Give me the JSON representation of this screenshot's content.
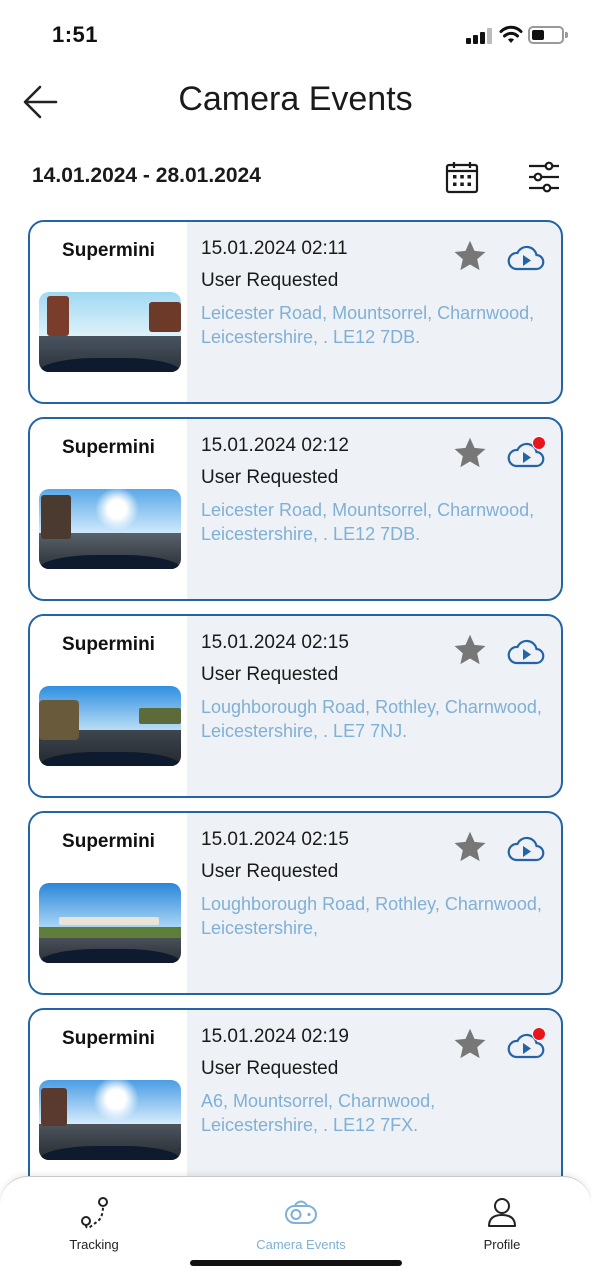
{
  "status_bar": {
    "time": "1:51"
  },
  "header": {
    "title": "Camera Events"
  },
  "date_range": "14.01.2024 - 28.01.2024",
  "colors": {
    "accent": "#2463a8",
    "address": "#7fb0d6",
    "new_badge": "#e8151b",
    "star": "#777777"
  },
  "events": [
    {
      "vehicle": "Supermini",
      "datetime": "15.01.2024 02:11",
      "type": "User Requested",
      "address": "Leicester Road, Mountsorrel, Charnwood, Leicestershire, . LE12 7DB.",
      "is_new": false
    },
    {
      "vehicle": "Supermini",
      "datetime": "15.01.2024 02:12",
      "type": "User Requested",
      "address": "Leicester Road, Mountsorrel, Charnwood, Leicestershire, . LE12 7DB.",
      "is_new": true
    },
    {
      "vehicle": "Supermini",
      "datetime": "15.01.2024 02:15",
      "type": "User Requested",
      "address": "Loughborough Road, Rothley, Charnwood, Leicestershire, . LE7 7NJ.",
      "is_new": false
    },
    {
      "vehicle": "Supermini",
      "datetime": "15.01.2024 02:15",
      "type": "User Requested",
      "address": "Loughborough Road, Rothley, Charnwood, Leicestershire,",
      "is_new": false
    },
    {
      "vehicle": "Supermini",
      "datetime": "15.01.2024 02:19",
      "type": "User Requested",
      "address": "A6, Mountsorrel, Charnwood, Leicestershire, . LE12 7FX.",
      "is_new": true
    }
  ],
  "nav": {
    "items": [
      {
        "label": "Tracking",
        "icon": "route-icon"
      },
      {
        "label": "Camera Events",
        "icon": "camera-icon",
        "active": true
      },
      {
        "label": "Profile",
        "icon": "user-icon"
      }
    ]
  }
}
